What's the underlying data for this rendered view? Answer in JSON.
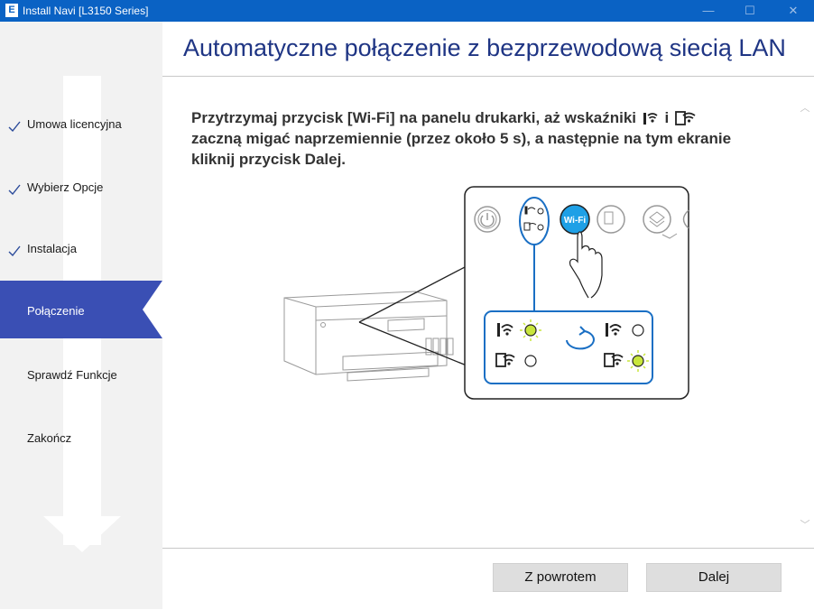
{
  "window": {
    "title": "Install Navi [L3150 Series]",
    "app_icon_letter": "E",
    "minimize": "—",
    "maximize": "☐",
    "close": "✕"
  },
  "sidebar": {
    "steps": [
      {
        "label": "Umowa licencyjna",
        "done": true
      },
      {
        "label": "Wybierz Opcje",
        "done": true
      },
      {
        "label": "Instalacja",
        "done": true
      },
      {
        "label": "Połączenie",
        "active": true
      },
      {
        "label": "Sprawdź Funkcje"
      },
      {
        "label": "Zakończ"
      }
    ]
  },
  "header": {
    "title": "Automatyczne połączenie z bezprzewodową siecią LAN"
  },
  "instruction": {
    "part1": "Przytrzymaj przycisk [Wi-Fi] na panelu drukarki, aż wskaźniki",
    "conj": "i",
    "part2": "zaczną migać naprzemiennie (przez około 5 s), a następnie na tym ekranie kliknij przycisk Dalej."
  },
  "illustration": {
    "wifi_button_label": "Wi-Fi"
  },
  "footer": {
    "back_label": "Z powrotem",
    "next_label": "Dalej"
  },
  "colors": {
    "titlebar": "#0a62c4",
    "accent": "#3a4fb4",
    "title_text": "#1f3584",
    "illustration_blue": "#1a6fc4",
    "wifi_button": "#1ea0e6",
    "led_green": "#c8e63c"
  }
}
